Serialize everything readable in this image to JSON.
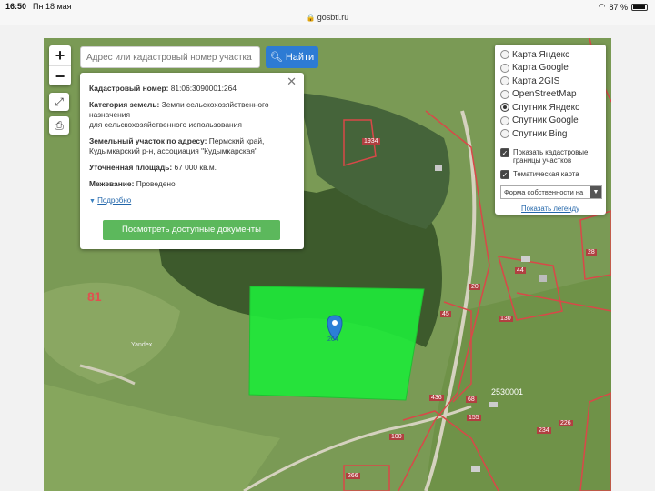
{
  "status_bar": {
    "time": "16:50",
    "date": "Пн 18 мая",
    "battery": "87 %"
  },
  "browser": {
    "url": "gosbti.ru"
  },
  "map_controls": {
    "zoom_in": "+",
    "zoom_out": "−"
  },
  "search": {
    "placeholder": "Адрес или кадастровый номер участка",
    "button_label": "Найти"
  },
  "info_panel": {
    "cadastral_label": "Кадастровый номер:",
    "cadastral_value": "81:06:3090001:264",
    "category_label": "Категория земель:",
    "category_value": "Земли сельскохозяйственного назначения",
    "category_value_2": "для сельскохозяйственного использования",
    "address_label": "Земельный участок по адресу:",
    "address_value": "Пермский край,",
    "address_value_2": "Кудымкарский р-н, ассоциация \"Кудымкарская\"",
    "area_label": "Уточненная площадь:",
    "area_value": "67 000 кв.м.",
    "survey_label": "Межевание:",
    "survey_value": "Проведено",
    "more_label": "Подробно",
    "docs_button": "Посмотреть доступные документы"
  },
  "layers_panel": {
    "options": [
      {
        "label": "Карта Яндекс",
        "selected": false
      },
      {
        "label": "Карта Google",
        "selected": false
      },
      {
        "label": "Карта 2GIS",
        "selected": false
      },
      {
        "label": "OpenStreetMap",
        "selected": false
      },
      {
        "label": "Спутник Яндекс",
        "selected": true
      },
      {
        "label": "Спутник Google",
        "selected": false
      },
      {
        "label": "Спутник Bing",
        "selected": false
      }
    ],
    "show_cadastral": "Показать кадастровые границы участков",
    "thematic_map": "Тематическая карта",
    "select_value": "Форма собственности на",
    "legend_link": "Показать легенду"
  },
  "map_labels": {
    "district": "81",
    "quarter": "2530001",
    "yandex": "Yandex",
    "plot_1934": "1934",
    "plot_264": "264",
    "plot_44": "44",
    "plot_28": "28",
    "plot_20": "20",
    "plot_45": "45",
    "plot_130": "130",
    "plot_68": "68",
    "plot_155": "155",
    "plot_234": "234",
    "plot_100": "100",
    "plot_266": "266",
    "plot_436": "436",
    "plot_226": "226"
  },
  "colors": {
    "accent": "#2d7bd4",
    "docs_button": "#5cb85c",
    "highlight_plot": "#1ee83a",
    "cadastral_border": "#d94848"
  }
}
